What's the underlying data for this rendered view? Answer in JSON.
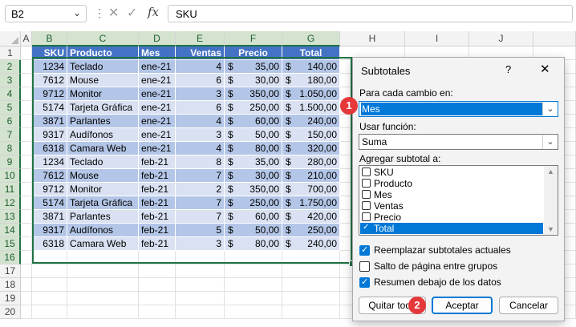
{
  "formula_bar": {
    "name_box": "B2",
    "formula": "SKU",
    "cancel_glyph": "✕",
    "enter_glyph": "✓",
    "fx_glyph": "fx"
  },
  "columns": [
    "A",
    "B",
    "C",
    "D",
    "E",
    "F",
    "G",
    "H",
    "I",
    "J"
  ],
  "rows": [
    "1",
    "2",
    "3",
    "4",
    "5",
    "6",
    "7",
    "8",
    "9",
    "10",
    "11",
    "12",
    "13",
    "14",
    "15",
    "16",
    "17",
    "18",
    "19",
    "20"
  ],
  "table": {
    "headers": [
      "SKU",
      "Producto",
      "Mes",
      "Ventas",
      "Precio",
      "Total"
    ],
    "currency": "$",
    "rows": [
      [
        "1234",
        "Teclado",
        "ene-21",
        "4",
        "35,00",
        "140,00"
      ],
      [
        "7612",
        "Mouse",
        "ene-21",
        "6",
        "30,00",
        "180,00"
      ],
      [
        "9712",
        "Monitor",
        "ene-21",
        "3",
        "350,00",
        "1.050,00"
      ],
      [
        "5174",
        "Tarjeta Gráfica",
        "ene-21",
        "6",
        "250,00",
        "1.500,00"
      ],
      [
        "3871",
        "Parlantes",
        "ene-21",
        "4",
        "60,00",
        "240,00"
      ],
      [
        "9317",
        "Audífonos",
        "ene-21",
        "3",
        "50,00",
        "150,00"
      ],
      [
        "6318",
        "Camara Web",
        "ene-21",
        "4",
        "80,00",
        "320,00"
      ],
      [
        "1234",
        "Teclado",
        "feb-21",
        "8",
        "35,00",
        "280,00"
      ],
      [
        "7612",
        "Mouse",
        "feb-21",
        "7",
        "30,00",
        "210,00"
      ],
      [
        "9712",
        "Monitor",
        "feb-21",
        "2",
        "350,00",
        "700,00"
      ],
      [
        "5174",
        "Tarjeta Gráfica",
        "feb-21",
        "7",
        "250,00",
        "1.750,00"
      ],
      [
        "3871",
        "Parlantes",
        "feb-21",
        "7",
        "60,00",
        "420,00"
      ],
      [
        "9317",
        "Audífonos",
        "feb-21",
        "5",
        "50,00",
        "250,00"
      ],
      [
        "6318",
        "Camara Web",
        "feb-21",
        "3",
        "80,00",
        "240,00"
      ]
    ]
  },
  "dialog": {
    "title": "Subtotales",
    "help": "?",
    "close": "✕",
    "change_label": "Para cada cambio en:",
    "change_value": "Mes",
    "function_label": "Usar función:",
    "function_value": "Suma",
    "add_label": "Agregar subtotal a:",
    "list_items": [
      {
        "label": "SKU",
        "checked": false
      },
      {
        "label": "Producto",
        "checked": false
      },
      {
        "label": "Mes",
        "checked": false
      },
      {
        "label": "Ventas",
        "checked": false
      },
      {
        "label": "Precio",
        "checked": false
      },
      {
        "label": "Total",
        "checked": true
      }
    ],
    "opt_replace": "Reemplazar subtotales actuales",
    "opt_pagebreak": "Salto de página entre grupos",
    "opt_summary": "Resumen debajo de los datos",
    "btn_remove": "Quitar todo",
    "btn_accept": "Aceptar",
    "btn_cancel": "Cancelar"
  },
  "badges": [
    "1",
    "2"
  ]
}
